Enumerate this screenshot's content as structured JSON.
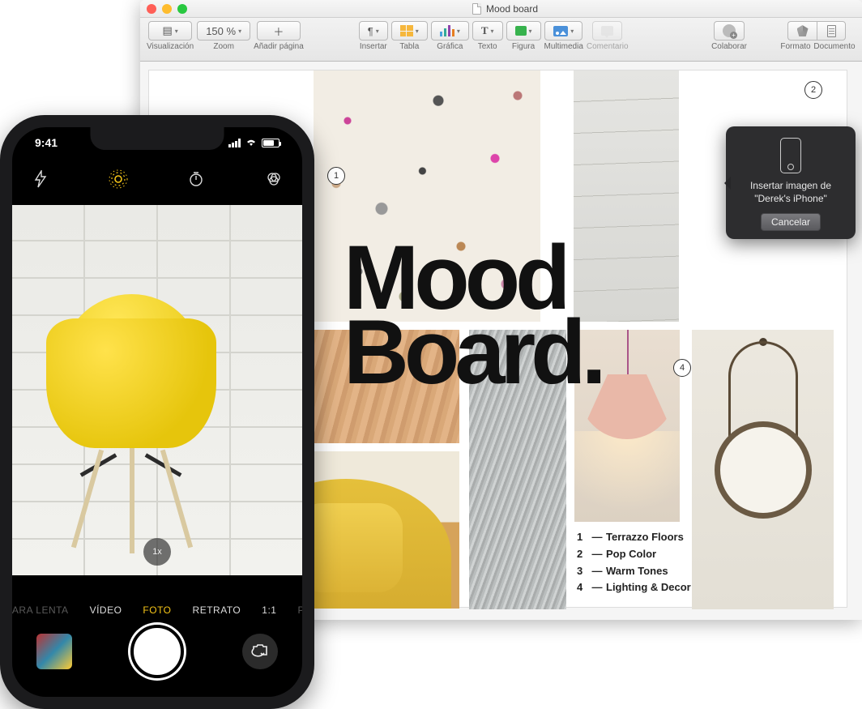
{
  "window": {
    "title": "Mood board"
  },
  "toolbar": {
    "view": "Visualización",
    "zoom_value": "150 %",
    "zoom_label": "Zoom",
    "add_page": "Añadir página",
    "insert": "Insertar",
    "table": "Tabla",
    "chart": "Gráfica",
    "text": "Texto",
    "shape": "Figura",
    "media": "Multimedia",
    "comment": "Comentario",
    "collaborate": "Colaborar",
    "format": "Formato",
    "document": "Documento"
  },
  "moodboard": {
    "title_line1": "Mood",
    "title_line2": "Board.",
    "legend": [
      {
        "n": "1",
        "label": "Terrazzo Floors"
      },
      {
        "n": "2",
        "label": "Pop Color"
      },
      {
        "n": "3",
        "label": "Warm Tones"
      },
      {
        "n": "4",
        "label": "Lighting & Decor"
      }
    ],
    "callouts": {
      "c1": "1",
      "c2": "2",
      "c4": "4"
    }
  },
  "popover": {
    "line1": "Insertar imagen de",
    "line2": "\"Derek's iPhone\"",
    "cancel": "Cancelar"
  },
  "iphone": {
    "time": "9:41",
    "zoom": "1x",
    "modes": {
      "slowmo": "MARA LENTA",
      "video": "VÍDEO",
      "photo": "FOTO",
      "portrait": "RETRATO",
      "square": "1:1",
      "pano": "PA"
    }
  }
}
